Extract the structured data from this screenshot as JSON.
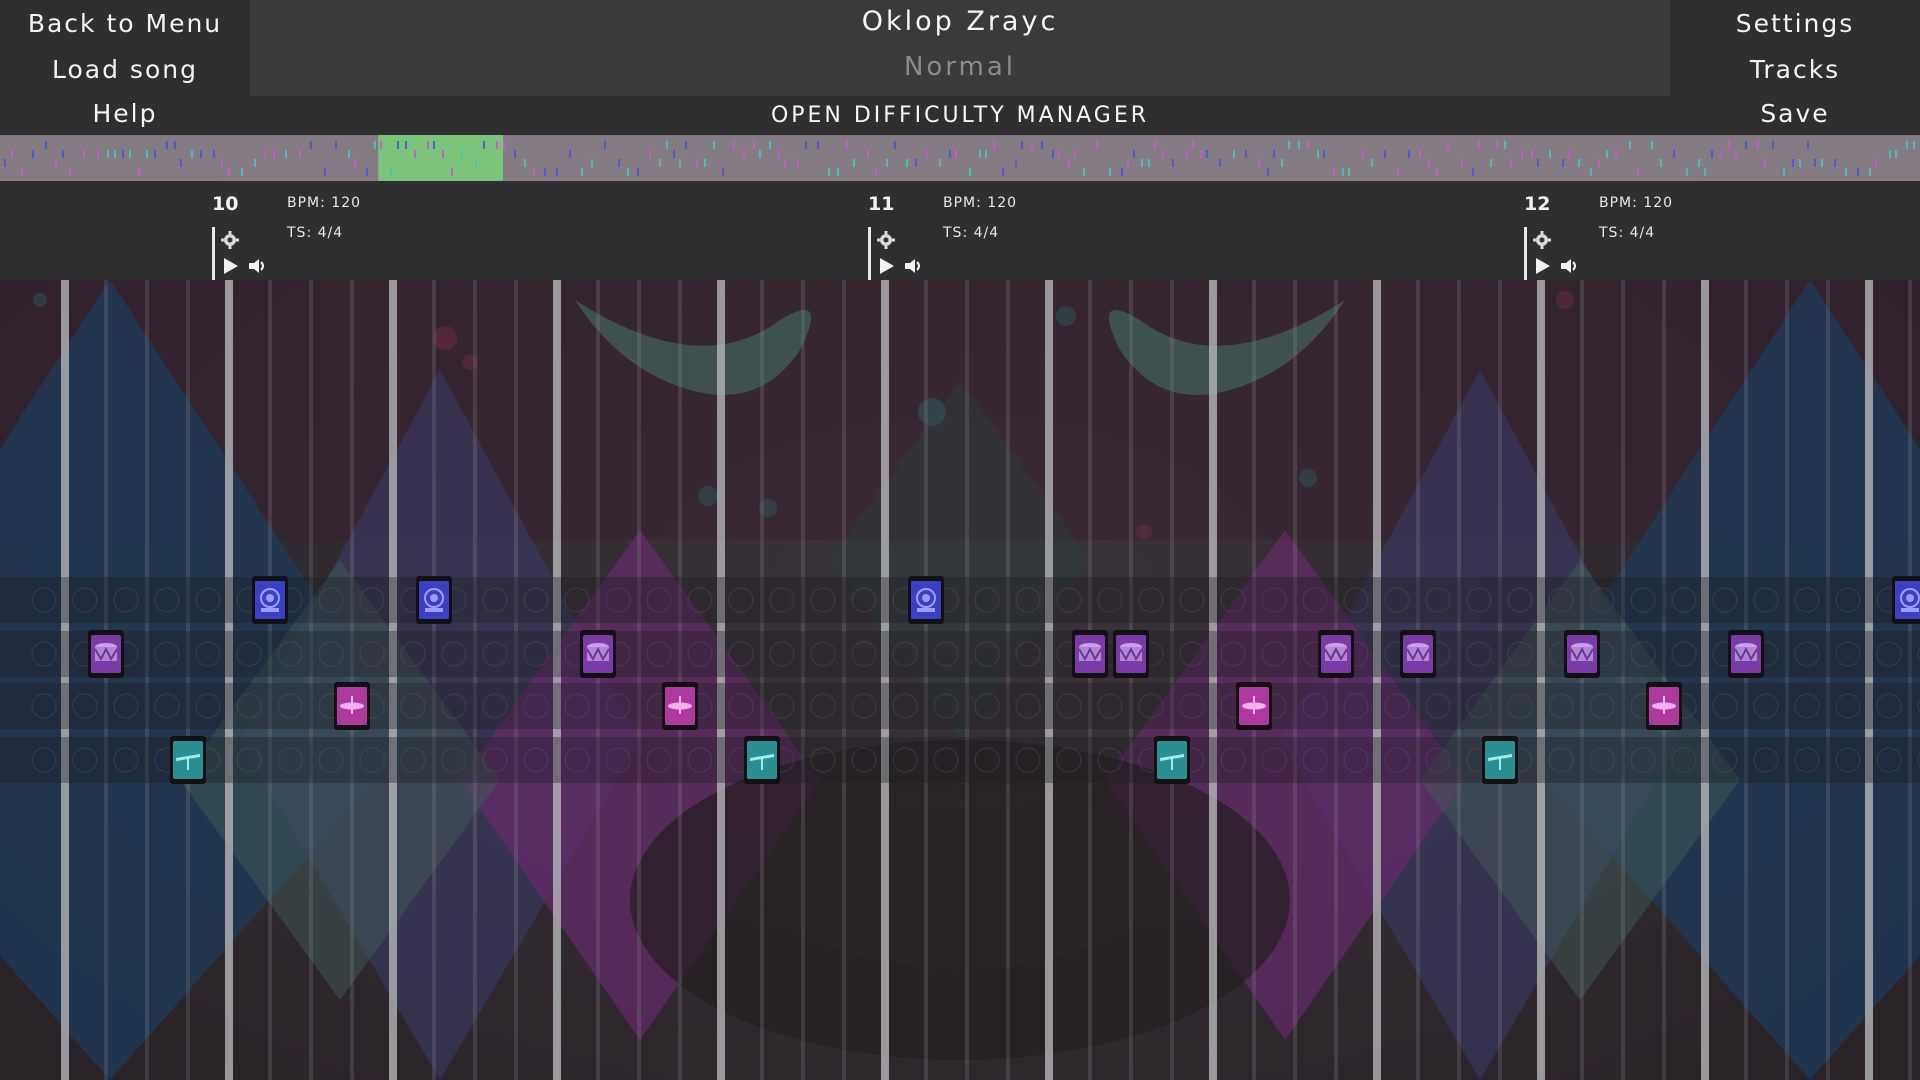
{
  "menu_left": {
    "back": "Back to Menu",
    "load": "Load song",
    "help": "Help"
  },
  "menu_right": {
    "settings": "Settings",
    "tracks": "Tracks",
    "save": "Save"
  },
  "song": {
    "title": "Oklop Zrayc",
    "difficulty": "Normal",
    "open_difficulty_manager": "OPEN DIFFICULTY MANAGER"
  },
  "overview": {
    "playhead_start_fraction": 0.197,
    "playhead_end_fraction": 0.262,
    "playhead_color": "#7cc47a",
    "note_colors": [
      "#cf55d6",
      "#4a55e0",
      "#3fc7be"
    ]
  },
  "measures": [
    {
      "number": "10",
      "bpm": "BPM: 120",
      "ts": "TS: 4/4"
    },
    {
      "number": "11",
      "bpm": "BPM: 120",
      "ts": "TS: 4/4"
    },
    {
      "number": "12",
      "bpm": "BPM: 120",
      "ts": "TS: 4/4"
    }
  ],
  "lanes": [
    {
      "name": "kick",
      "icon": "kick-drum-icon",
      "color": "#3b3fc4"
    },
    {
      "name": "snare",
      "icon": "snare-drum-icon",
      "color": "#7b3aa8"
    },
    {
      "name": "tom",
      "icon": "tom-drum-icon",
      "color": "#b0399f"
    },
    {
      "name": "cymbal",
      "icon": "cymbal-icon",
      "color": "#2a8f92"
    }
  ],
  "notes": [
    {
      "lane": 0,
      "beat": 5
    },
    {
      "lane": 0,
      "beat": 9
    },
    {
      "lane": 0,
      "beat": 21
    },
    {
      "lane": 0,
      "beat": 45
    },
    {
      "lane": 1,
      "beat": 1
    },
    {
      "lane": 1,
      "beat": 13
    },
    {
      "lane": 1,
      "beat": 25
    },
    {
      "lane": 1,
      "beat": 26
    },
    {
      "lane": 1,
      "beat": 31
    },
    {
      "lane": 1,
      "beat": 33
    },
    {
      "lane": 1,
      "beat": 37
    },
    {
      "lane": 1,
      "beat": 41
    },
    {
      "lane": 2,
      "beat": 7
    },
    {
      "lane": 2,
      "beat": 15
    },
    {
      "lane": 2,
      "beat": 29
    },
    {
      "lane": 2,
      "beat": 39
    },
    {
      "lane": 3,
      "beat": 3
    },
    {
      "lane": 3,
      "beat": 17
    },
    {
      "lane": 3,
      "beat": 27
    },
    {
      "lane": 3,
      "beat": 35
    }
  ]
}
